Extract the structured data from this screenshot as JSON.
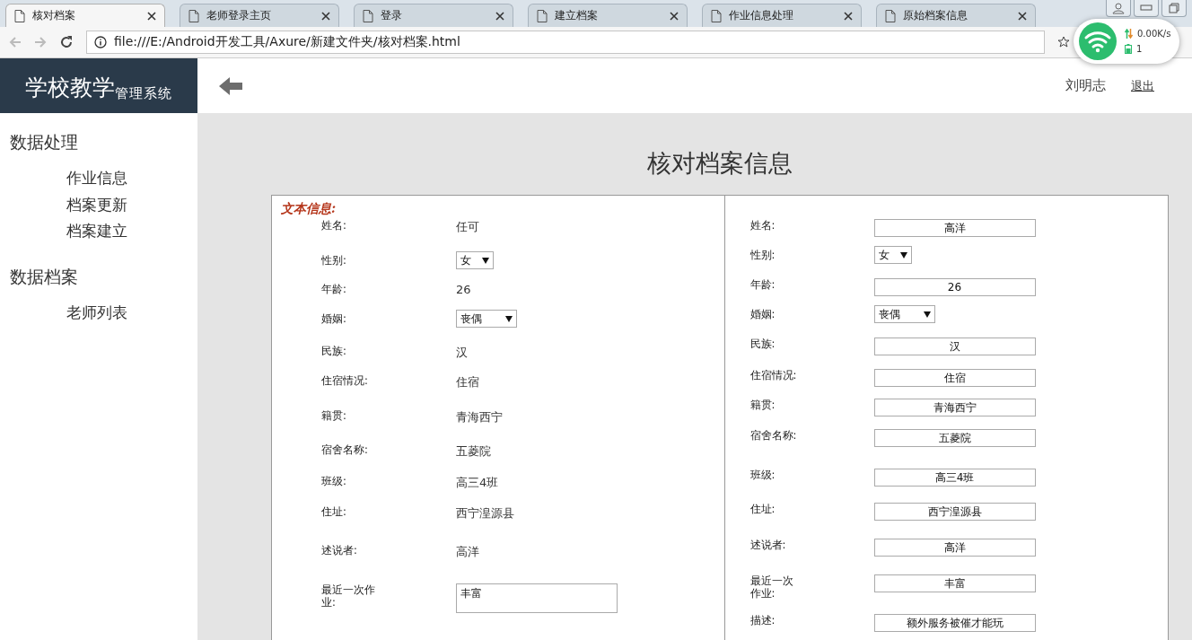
{
  "browser": {
    "tabs": [
      {
        "title": "核对档案",
        "selected": true
      },
      {
        "title": "老师登录主页",
        "selected": false
      },
      {
        "title": "登录",
        "selected": false
      },
      {
        "title": "建立档案",
        "selected": false
      },
      {
        "title": "作业信息处理",
        "selected": false
      },
      {
        "title": "原始档案信息",
        "selected": false
      }
    ],
    "url": "file:///E:/Android开发工具/Axure/新建文件夹/核对档案.html",
    "network_widget": {
      "speed": "0.00K/s",
      "count": "1"
    }
  },
  "header": {
    "logo": {
      "title": "学校教学",
      "subtitle": "管理系统"
    },
    "user": "刘明志",
    "logout": "退出"
  },
  "sidebar": {
    "sections": [
      {
        "heading": "数据处理",
        "items": [
          {
            "label": "作业信息"
          },
          {
            "label": "档案更新"
          },
          {
            "label": "档案建立"
          }
        ]
      },
      {
        "heading": "数据档案",
        "items": [
          {
            "label": "老师列表"
          }
        ]
      }
    ]
  },
  "page_title": "核对档案信息",
  "original_panel": {
    "heading": "文本信息:",
    "fields": [
      {
        "label": "姓名:",
        "kind": "text",
        "value": "任可"
      },
      {
        "label": "性别:",
        "kind": "select",
        "value": "女"
      },
      {
        "label": "年龄:",
        "kind": "text",
        "value": "26"
      },
      {
        "label": "婚姻:",
        "kind": "select",
        "value": "丧偶"
      },
      {
        "label": "民族:",
        "kind": "text",
        "value": "汉"
      },
      {
        "label": "住宿情况:",
        "kind": "text",
        "value": "住宿"
      },
      {
        "label": "籍贯:",
        "kind": "text",
        "value": "青海西宁"
      },
      {
        "label": "宿舍名称:",
        "kind": "text",
        "value": "五菱院"
      },
      {
        "label": "班级:",
        "kind": "text",
        "value": "高三4班"
      },
      {
        "label": "住址:",
        "kind": "text",
        "value": "西宁湟源县"
      },
      {
        "label": "述说者:",
        "kind": "text",
        "value": "高洋"
      },
      {
        "label": "最近一次作业:",
        "kind": "textarea",
        "value": "丰富"
      }
    ]
  },
  "edit_panel": {
    "fields": [
      {
        "label": "姓名:",
        "kind": "input",
        "value": "高洋"
      },
      {
        "label": "性别:",
        "kind": "select",
        "value": "女"
      },
      {
        "label": "年龄:",
        "kind": "input",
        "value": "26"
      },
      {
        "label": "婚姻:",
        "kind": "select",
        "value": "丧偶"
      },
      {
        "label": "民族:",
        "kind": "input",
        "value": "汉"
      },
      {
        "label": "住宿情况:",
        "kind": "input",
        "value": "住宿"
      },
      {
        "label": "籍贯:",
        "kind": "input",
        "value": "青海西宁"
      },
      {
        "label": "宿舍名称:",
        "kind": "input",
        "value": "五菱院"
      },
      {
        "label": "班级:",
        "kind": "input",
        "value": "高三4班"
      },
      {
        "label": "住址:",
        "kind": "input",
        "value": "西宁湟源县"
      },
      {
        "label": "述说者:",
        "kind": "input",
        "value": "高洋"
      },
      {
        "label": "最近一次作业:",
        "kind": "input",
        "value": "丰富"
      },
      {
        "label": "描述:",
        "kind": "input",
        "value": "额外服务被催才能玩"
      }
    ]
  }
}
